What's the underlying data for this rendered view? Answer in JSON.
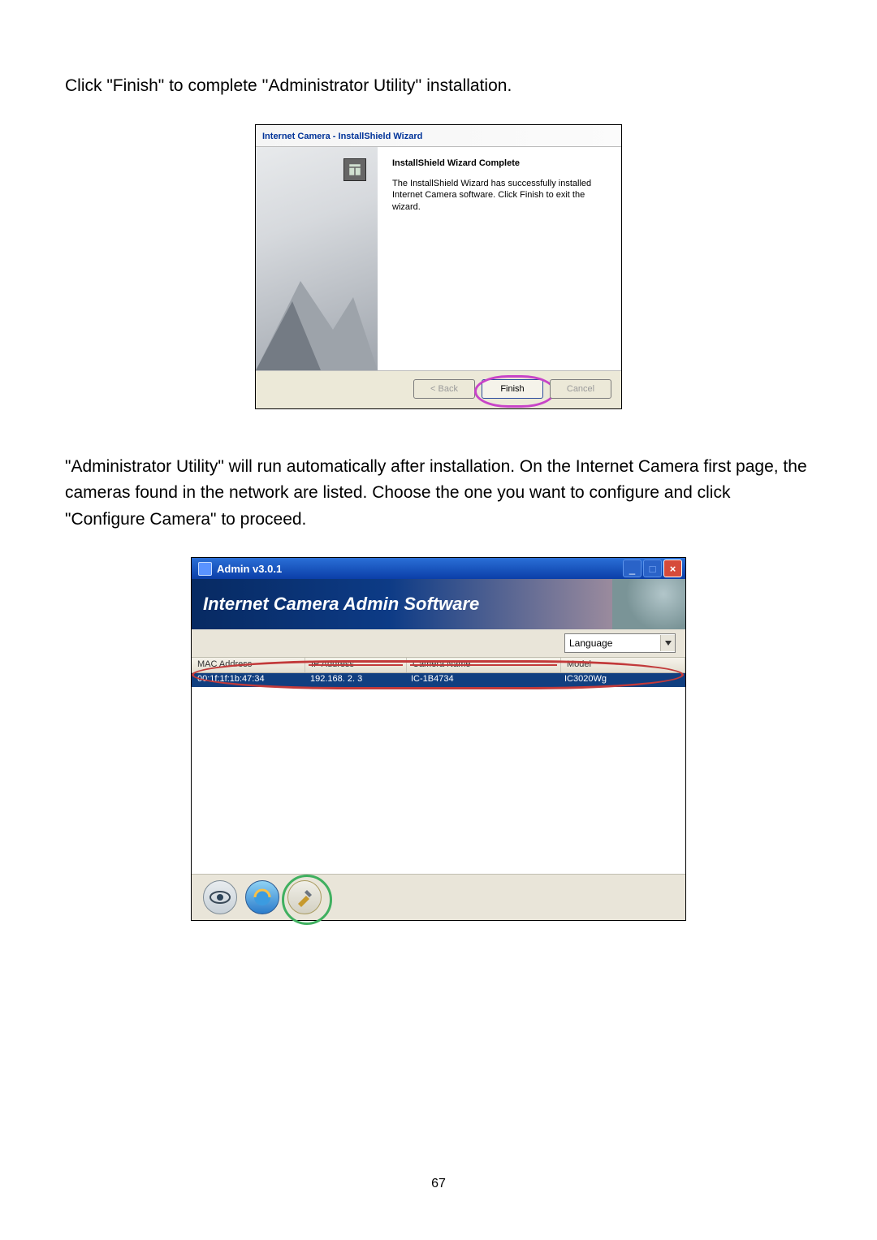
{
  "paragraphs": {
    "p1": "Click \"Finish\" to complete ''Administrator Utility'' installation.",
    "p2": "\"Administrator Utility\" will run automatically after installation. On the Internet Camera first page, the cameras found in the network are listed. Choose the one you want to configure and click \"Configure Camera\" to proceed."
  },
  "page_number": "67",
  "wizard": {
    "window_title": "Internet Camera - InstallShield Wizard",
    "heading": "InstallShield Wizard Complete",
    "body": "The InstallShield Wizard has successfully installed Internet Camera software. Click Finish to exit the wizard.",
    "buttons": {
      "back": "< Back",
      "finish": "Finish",
      "cancel": "Cancel"
    }
  },
  "admin": {
    "title": "Admin v3.0.1",
    "banner": "Internet Camera Admin Software",
    "language_label": "Language",
    "columns": {
      "mac": "MAC Address",
      "ip": "IP Address",
      "name": "Camera Name",
      "model": "Model"
    },
    "row": {
      "mac": "00:1f:1f:1b:47:34",
      "ip": "192.168.  2.  3",
      "name": "IC-1B4734",
      "model": "IC3020Wg"
    }
  }
}
